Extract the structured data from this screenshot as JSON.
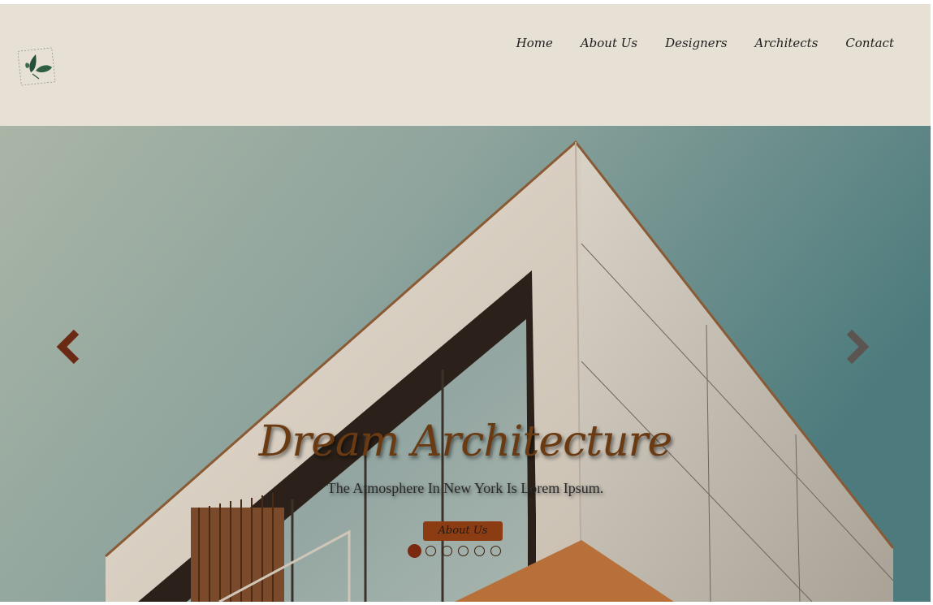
{
  "nav": {
    "items": [
      {
        "label": "Home"
      },
      {
        "label": "About Us"
      },
      {
        "label": "Designers"
      },
      {
        "label": "Architects"
      },
      {
        "label": "Contact"
      }
    ]
  },
  "hero": {
    "title": "Dream Architecture",
    "subtitle": "The Atmosphere In New York Is Lorem Ipsum.",
    "button_label": "About Us",
    "slide_count": 6,
    "active_slide": 1
  },
  "colors": {
    "header_bg": "#e7e0d5",
    "accent": "#8b3c12",
    "arrow_prev": "#6b2a14",
    "arrow_next": "#5b5450"
  },
  "icons": {
    "logo": "leaf-logo-icon",
    "prev": "chevron-left-icon",
    "next": "chevron-right-icon"
  }
}
